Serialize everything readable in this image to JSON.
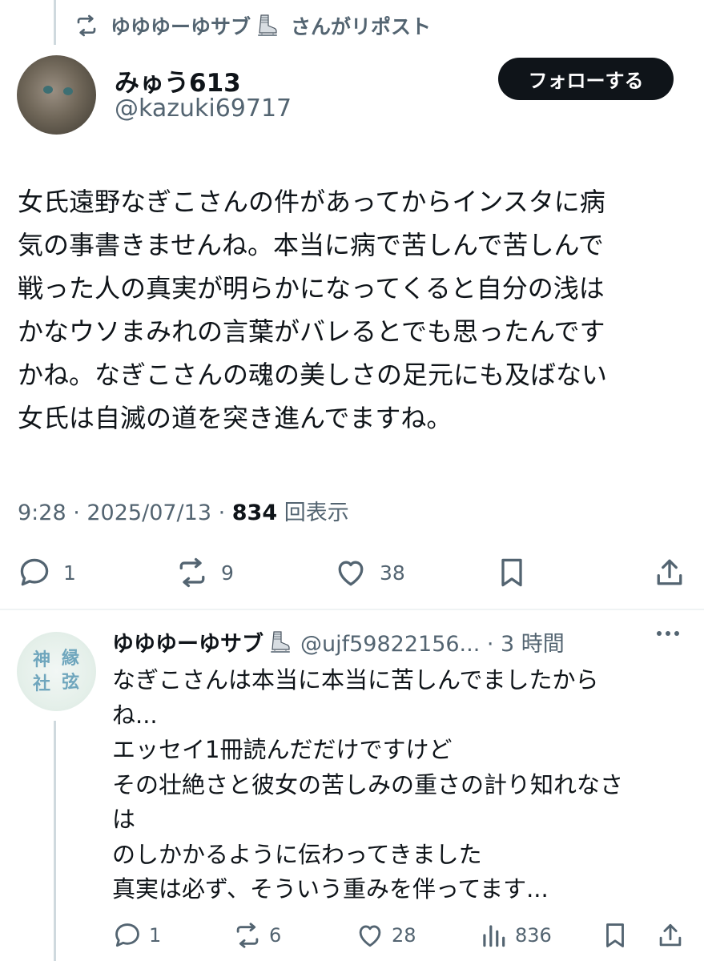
{
  "repost": {
    "text_prefix": "ゆゆゆーゆサブ",
    "text_suffix": "さんがリポスト",
    "icon": "repost-icon"
  },
  "tweet": {
    "author_name": "みゅう613",
    "author_handle": "@kazuki69717",
    "follow_label": "フォローする",
    "body_lines": [
      "女氏遠野なぎこさんの件があってからインスタに病",
      "気の事書きませんね。本当に病で苦しんで苦しんで",
      "戦った人の真実が明らかになってくると自分の浅は",
      "かなウソまみれの言葉がバレるとでも思ったんです",
      "かね。なぎこさんの魂の美しさの足元にも及ばない",
      "女氏は自滅の道を突き進んでますね。"
    ],
    "time": "9:28 · 2025/07/13 · ",
    "views_count": "834",
    "views_label": " 回表示",
    "actions": {
      "replies": "1",
      "reposts": "9",
      "likes": "38"
    }
  },
  "reply": {
    "author_name": "ゆゆゆーゆサブ",
    "author_handle": "@ujf59822156... · 3 時間",
    "avatar_text": [
      "神",
      "縁",
      "社",
      "弦"
    ],
    "body_lines": [
      "なぎこさんは本当に本当に苦しんでましたから",
      "ね...",
      "エッセイ1冊読んだだけですけど",
      "その壮絶さと彼女の苦しみの重さの計り知れなさ",
      "は",
      "のしかかるように伝わってきました",
      "真実は必ず、そういう重みを伴ってます..."
    ],
    "actions": {
      "replies": "1",
      "reposts": "6",
      "likes": "28",
      "views": "836"
    }
  },
  "colors": {
    "text": "#0f1419",
    "secondary": "#536471",
    "divider": "#eff3f4",
    "thread_line": "#cfd9de",
    "follow_bg": "#0f1419"
  }
}
